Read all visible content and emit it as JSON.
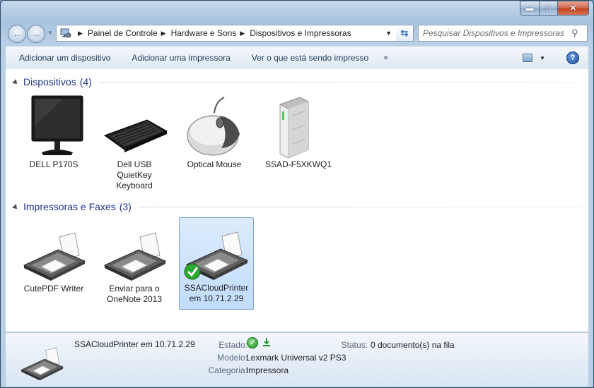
{
  "address": {
    "crumbs": [
      "Painel de Controle",
      "Hardware e Sons",
      "Dispositivos e Impressoras"
    ]
  },
  "search": {
    "placeholder": "Pesquisar Dispositivos e Impressoras"
  },
  "toolbar": {
    "add_device": "Adicionar um dispositivo",
    "add_printer": "Adicionar uma impressora",
    "see_printing": "Ver o que está sendo impresso",
    "more": "»"
  },
  "devices_group": {
    "title": "Dispositivos",
    "count": "(4)",
    "items": [
      {
        "label": "DELL P170S",
        "icon": "monitor-icon"
      },
      {
        "label": "Dell USB QuietKey Keyboard",
        "icon": "keyboard-icon"
      },
      {
        "label": "Optical Mouse",
        "icon": "mouse-icon"
      },
      {
        "label": "SSAD-F5XKWQ1",
        "icon": "computer-tower-icon"
      }
    ]
  },
  "printers_group": {
    "title": "Impressoras e Faxes",
    "count": "(3)",
    "items": [
      {
        "label": "CutePDF Writer",
        "icon": "printer-icon"
      },
      {
        "label": "Enviar para o OneNote 2013",
        "icon": "printer-icon"
      },
      {
        "label": "SSACloudPrinter em 10.71.2.29",
        "icon": "printer-icon",
        "default": true,
        "selected": true
      }
    ]
  },
  "details": {
    "name": "SSACloudPrinter em 10.71.2.29",
    "state_label": "Estado:",
    "status_label": "Status:",
    "status_value": "0 documento(s) na fila",
    "model_label": "Modelo:",
    "model_value": "Lexmark Universal v2 PS3",
    "category_label": "Categoria:",
    "category_value": "Impressora"
  },
  "colors": {
    "group_title": "#1e3287",
    "selection": "#c1dcfc",
    "toolbar_text": "#1e3954"
  }
}
